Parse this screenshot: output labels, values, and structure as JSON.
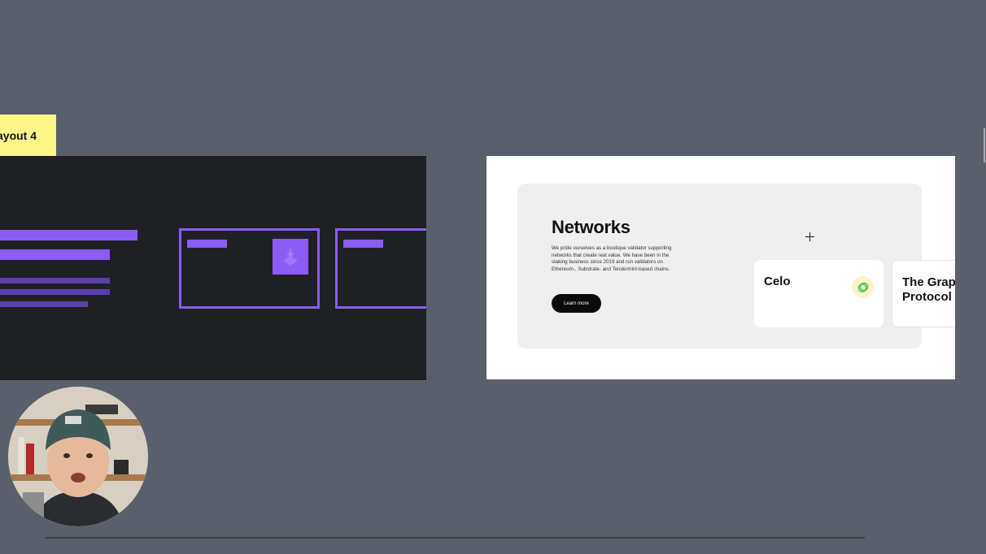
{
  "canvas": {
    "background_color": "#5a606b"
  },
  "layout_label": {
    "text": "ayout 4",
    "color": "#fdf58a"
  },
  "wireframe": {
    "accent_color": "#8b5cf6",
    "background_color": "#1f2024"
  },
  "preview": {
    "title": "Networks",
    "description": "We pride ourselves as a boutique validator supporting networks that create real value. We have been in the staking business since 2019 and run validators on Ethereum-, Substrate- and Tendermint-based chains.",
    "button_label": "Learn more",
    "cards": [
      {
        "name": "Celo",
        "icon": "celo-logo-icon"
      },
      {
        "name": "The Graph Protocol",
        "icon": ""
      }
    ]
  },
  "webcam": {
    "icon": "presenter-webcam-avatar"
  }
}
